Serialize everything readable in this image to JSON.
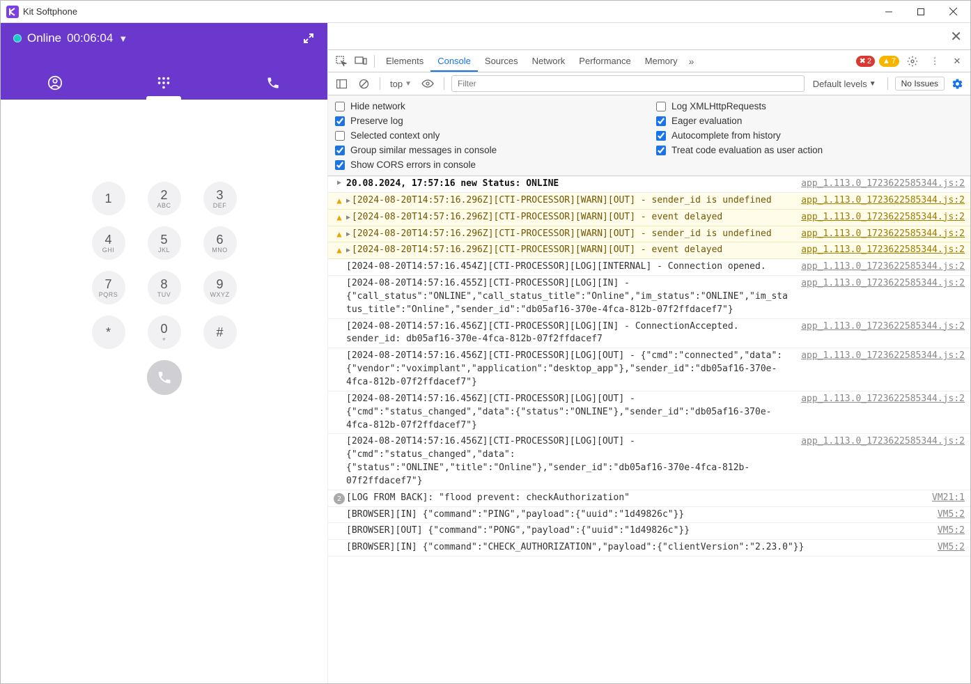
{
  "window": {
    "title": "Kit Softphone"
  },
  "header": {
    "status_label": "Online",
    "timer": "00:06:04"
  },
  "dialpad": {
    "keys": [
      {
        "num": "1",
        "let": ""
      },
      {
        "num": "2",
        "let": "ABC"
      },
      {
        "num": "3",
        "let": "DEF"
      },
      {
        "num": "4",
        "let": "GHI"
      },
      {
        "num": "5",
        "let": "JKL"
      },
      {
        "num": "6",
        "let": "MNO"
      },
      {
        "num": "7",
        "let": "PQRS"
      },
      {
        "num": "8",
        "let": "TUV"
      },
      {
        "num": "9",
        "let": "WXYZ"
      },
      {
        "num": "*",
        "let": ""
      },
      {
        "num": "0",
        "let": "+"
      },
      {
        "num": "#",
        "let": ""
      }
    ]
  },
  "devtools": {
    "tabs": [
      "Elements",
      "Console",
      "Sources",
      "Network",
      "Performance",
      "Memory"
    ],
    "active_tab": "Console",
    "error_count": "2",
    "warn_count": "7",
    "context": "top",
    "filter_placeholder": "Filter",
    "levels_label": "Default levels",
    "issues_label": "No Issues",
    "filters": {
      "hide_network": {
        "label": "Hide network",
        "checked": false
      },
      "log_xhr": {
        "label": "Log XMLHttpRequests",
        "checked": false
      },
      "preserve_log": {
        "label": "Preserve log",
        "checked": true
      },
      "eager_eval": {
        "label": "Eager evaluation",
        "checked": true
      },
      "selected_ctx": {
        "label": "Selected context only",
        "checked": false
      },
      "autocomplete": {
        "label": "Autocomplete from history",
        "checked": true
      },
      "group_similar": {
        "label": "Group similar messages in console",
        "checked": true
      },
      "treat_eval": {
        "label": "Treat code evaluation as user action",
        "checked": true
      },
      "show_cors": {
        "label": "Show CORS errors in console",
        "checked": true
      }
    },
    "logs": [
      {
        "type": "status",
        "caret": true,
        "msg": "20.08.2024, 17:57:16 new Status: ONLINE",
        "src": "app_1.113.0_1723622585344.js:2"
      },
      {
        "type": "warn",
        "caret": true,
        "msg": "[2024-08-20T14:57:16.296Z][CTI-PROCESSOR][WARN][OUT] - sender_id is undefined",
        "src": "app_1.113.0_1723622585344.js:2"
      },
      {
        "type": "warn",
        "caret": true,
        "msg": "[2024-08-20T14:57:16.296Z][CTI-PROCESSOR][WARN][OUT] - event delayed",
        "src": "app_1.113.0_1723622585344.js:2"
      },
      {
        "type": "warn",
        "caret": true,
        "msg": "[2024-08-20T14:57:16.296Z][CTI-PROCESSOR][WARN][OUT] - sender_id is undefined",
        "src": "app_1.113.0_1723622585344.js:2"
      },
      {
        "type": "warn",
        "caret": true,
        "msg": "[2024-08-20T14:57:16.296Z][CTI-PROCESSOR][WARN][OUT] - event delayed",
        "src": "app_1.113.0_1723622585344.js:2"
      },
      {
        "type": "log",
        "msg": "[2024-08-20T14:57:16.454Z][CTI-PROCESSOR][LOG][INTERNAL] - Connection opened.",
        "src": "app_1.113.0_1723622585344.js:2"
      },
      {
        "type": "log",
        "msg": "[2024-08-20T14:57:16.455Z][CTI-PROCESSOR][LOG][IN] - {\"call_status\":\"ONLINE\",\"call_status_title\":\"Online\",\"im_status\":\"ONLINE\",\"im_status_title\":\"Online\",\"sender_id\":\"db05af16-370e-4fca-812b-07f2ffdacef7\"}",
        "src": "app_1.113.0_1723622585344.js:2"
      },
      {
        "type": "log",
        "msg": "[2024-08-20T14:57:16.456Z][CTI-PROCESSOR][LOG][IN] - ConnectionAccepted. sender_id: db05af16-370e-4fca-812b-07f2ffdacef7",
        "src": "app_1.113.0_1723622585344.js:2"
      },
      {
        "type": "log",
        "msg": "[2024-08-20T14:57:16.456Z][CTI-PROCESSOR][LOG][OUT] - {\"cmd\":\"connected\",\"data\":{\"vendor\":\"voximplant\",\"application\":\"desktop_app\"},\"sender_id\":\"db05af16-370e-4fca-812b-07f2ffdacef7\"}",
        "src": "app_1.113.0_1723622585344.js:2"
      },
      {
        "type": "log",
        "msg": "[2024-08-20T14:57:16.456Z][CTI-PROCESSOR][LOG][OUT] - {\"cmd\":\"status_changed\",\"data\":{\"status\":\"ONLINE\"},\"sender_id\":\"db05af16-370e-4fca-812b-07f2ffdacef7\"}",
        "src": "app_1.113.0_1723622585344.js:2"
      },
      {
        "type": "log",
        "msg": "[2024-08-20T14:57:16.456Z][CTI-PROCESSOR][LOG][OUT] - {\"cmd\":\"status_changed\",\"data\":{\"status\":\"ONLINE\",\"title\":\"Online\"},\"sender_id\":\"db05af16-370e-4fca-812b-07f2ffdacef7\"}",
        "src": "app_1.113.0_1723622585344.js:2"
      },
      {
        "type": "count",
        "count": "2",
        "msg": "[LOG FROM BACK]: \"flood prevent: checkAuthorization\"",
        "src": "VM21:1"
      },
      {
        "type": "log",
        "msg": "[BROWSER][IN] {\"command\":\"PING\",\"payload\":{\"uuid\":\"1d49826c\"}}",
        "src": "VM5:2"
      },
      {
        "type": "log",
        "msg": "[BROWSER][OUT] {\"command\":\"PONG\",\"payload\":{\"uuid\":\"1d49826c\"}}",
        "src": "VM5:2"
      },
      {
        "type": "log",
        "msg": "[BROWSER][IN] {\"command\":\"CHECK_AUTHORIZATION\",\"payload\":{\"clientVersion\":\"2.23.0\"}}",
        "src": "VM5:2"
      }
    ]
  }
}
